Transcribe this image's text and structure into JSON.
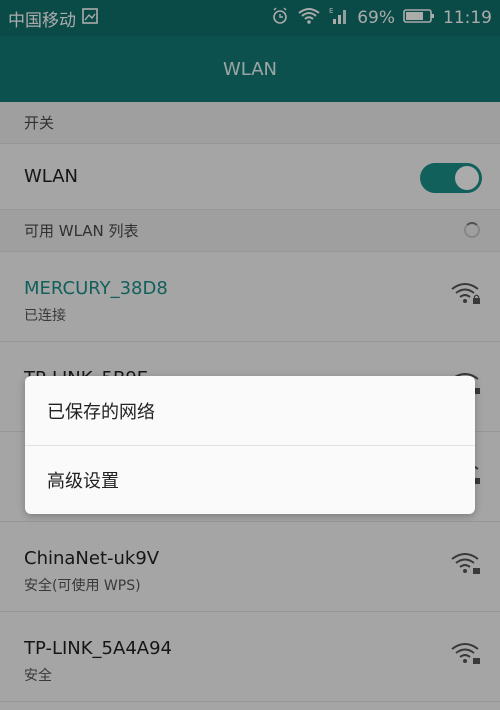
{
  "status_bar": {
    "carrier": "中国移动",
    "battery": "69%",
    "time": "11:19",
    "icons": [
      "picture-icon",
      "alarm-icon",
      "wifi-icon",
      "signal-icon",
      "battery-icon"
    ]
  },
  "title": "WLAN",
  "sections": {
    "switch_header": "开关",
    "available_header": "可用 WLAN 列表"
  },
  "wlan_toggle": {
    "label": "WLAN",
    "state": "on"
  },
  "networks": [
    {
      "ssid": "MERCURY_38D8",
      "status": "已连接",
      "connected": true
    },
    {
      "ssid": "TP-LINK_5B9E",
      "status": ""
    },
    {
      "ssid": "",
      "status": ""
    },
    {
      "ssid": "ChinaNet-uk9V",
      "status": "安全(可使用 WPS)"
    },
    {
      "ssid": "TP-LINK_5A4A94",
      "status": "安全"
    }
  ],
  "popup_menu": {
    "items": [
      "已保存的网络",
      "高级设置"
    ]
  },
  "colors": {
    "accent": "#1b8f89",
    "header": "#137a75",
    "status_bar": "#0f6f6b"
  }
}
